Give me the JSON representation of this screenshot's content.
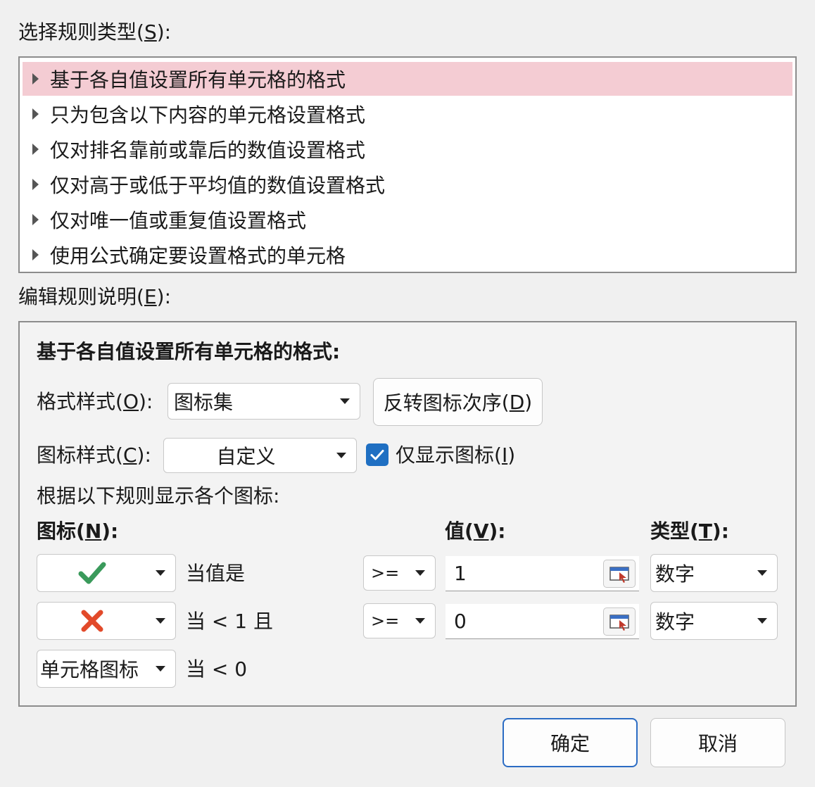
{
  "rule_type": {
    "label": "选择规则类型",
    "hotkey": "S",
    "suffix": "):",
    "items": [
      "基于各自值设置所有单元格的格式",
      "只为包含以下内容的单元格设置格式",
      "仅对排名靠前或靠后的数值设置格式",
      "仅对高于或低于平均值的数值设置格式",
      "仅对唯一值或重复值设置格式",
      "使用公式确定要设置格式的单元格"
    ]
  },
  "edit": {
    "label": "编辑规则说明",
    "hotkey": "E",
    "suffix": "):",
    "heading": "基于各自值设置所有单元格的格式:",
    "format_style": {
      "label": "格式样式",
      "hotkey": "O",
      "value": "图标集"
    },
    "reverse_button": {
      "label": "反转图标次序",
      "hotkey": "D"
    },
    "icon_style": {
      "label": "图标样式",
      "hotkey": "C",
      "value": "自定义"
    },
    "show_icon_only": {
      "label": "仅显示图标",
      "hotkey": "I",
      "checked": true
    },
    "rules_caption": "根据以下规则显示各个图标:",
    "col_icon": {
      "label": "图标",
      "hotkey": "N"
    },
    "col_value": {
      "label": "值",
      "hotkey": "V"
    },
    "col_type": {
      "label": "类型",
      "hotkey": "T"
    },
    "rows": [
      {
        "icon": "green-check-icon",
        "condition": "当值是",
        "operator": ">=",
        "value": "1",
        "type": "数字"
      },
      {
        "icon": "red-x-icon",
        "condition": "当 < 1 且",
        "operator": ">=",
        "value": "0",
        "type": "数字"
      },
      {
        "icon_text": "无单元格图标",
        "condition": "当 < 0"
      }
    ]
  },
  "buttons": {
    "ok": "确定",
    "cancel": "取消"
  },
  "colors": {
    "selection": "#f4ccd3",
    "accent": "#1f6fc2",
    "check": "#3a9a5b",
    "cross": "#e24a2a"
  }
}
